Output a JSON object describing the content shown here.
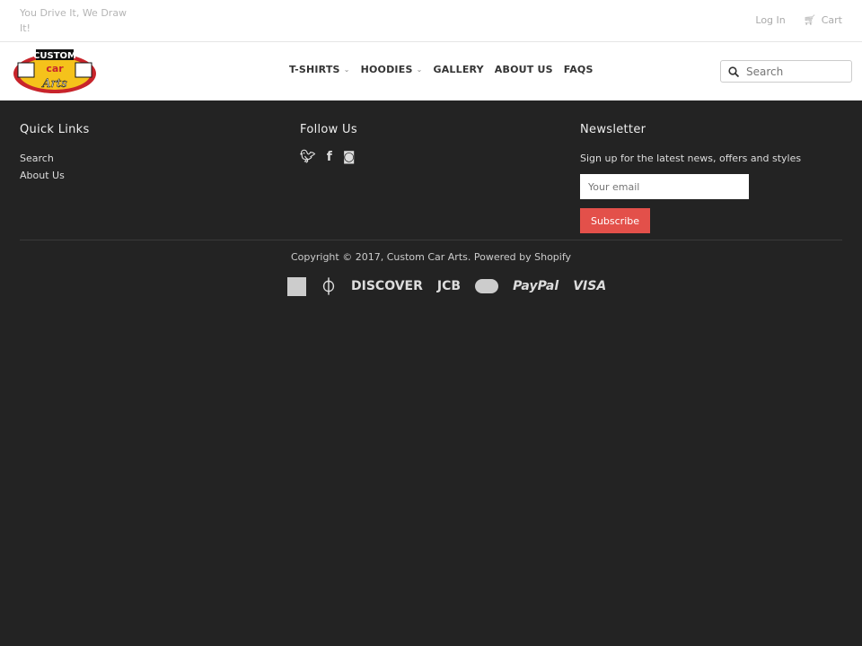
{
  "header": {
    "tagline": "You Drive It, We Draw It!",
    "login": "Log In",
    "cart": "Cart",
    "logo_text": "Custom Car Arts"
  },
  "nav": {
    "items": [
      {
        "label": "T-SHIRTS",
        "dropdown": true
      },
      {
        "label": "HOODIES",
        "dropdown": true
      },
      {
        "label": "GALLERY"
      },
      {
        "label": "ABOUT US"
      },
      {
        "label": "FAQS"
      }
    ]
  },
  "search": {
    "placeholder": "Search"
  },
  "footer": {
    "quick_links": {
      "title": "Quick Links",
      "items": [
        "Search",
        "About Us"
      ]
    },
    "follow": {
      "title": "Follow Us",
      "icons": [
        "twitter-icon",
        "facebook-icon",
        "instagram-icon"
      ]
    },
    "newsletter": {
      "title": "Newsletter",
      "text": "Sign up for the latest news, offers and styles",
      "placeholder": "Your email",
      "button": "Subscribe"
    },
    "copyright": "Copyright © 2017, Custom Car Arts. Powered by Shopify",
    "payments": [
      "American Express",
      "Diners Club",
      "DISCOVER",
      "JCB",
      "MasterCard",
      "PayPal",
      "VISA"
    ]
  },
  "colors": {
    "accent": "#e3504a",
    "footer_bg": "#232323"
  }
}
